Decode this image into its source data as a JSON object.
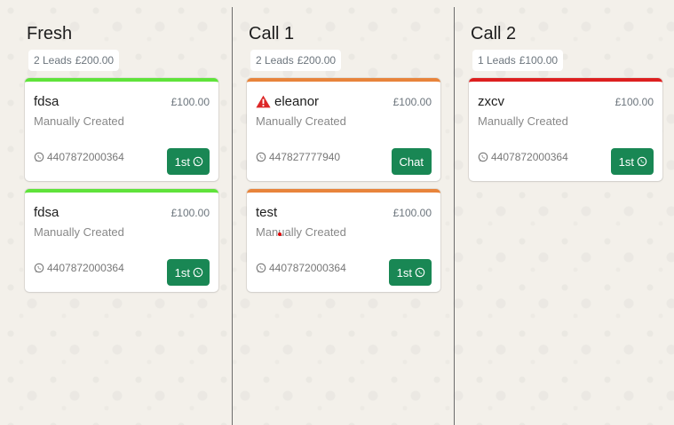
{
  "columns": [
    {
      "title": "Fresh",
      "lead_count": "2 Leads",
      "total": "£200.00",
      "cards": [
        {
          "name": "fdsa",
          "value": "£100.00",
          "source": "Manually Created",
          "phone": "4407872000364",
          "action": "1st",
          "stage_color": "#5fe33a",
          "warning": false
        },
        {
          "name": "fdsa",
          "value": "£100.00",
          "source": "Manually Created",
          "phone": "4407872000364",
          "action": "1st",
          "stage_color": "#5fe33a",
          "warning": false
        }
      ]
    },
    {
      "title": "Call 1",
      "lead_count": "2 Leads",
      "total": "£200.00",
      "cards": [
        {
          "name": "eleanor",
          "value": "£100.00",
          "source": "Manually Created",
          "phone": "447827777940",
          "action": "Chat",
          "stage_color": "#e8843b",
          "warning": true
        },
        {
          "name": "test",
          "value": "£100.00",
          "source": "Manually Created",
          "phone": "4407872000364",
          "action": "1st",
          "stage_color": "#e8843b",
          "warning": false
        }
      ]
    },
    {
      "title": "Call 2",
      "lead_count": "1 Leads",
      "total": "£100.00",
      "cards": [
        {
          "name": "zxcv",
          "value": "£100.00",
          "source": "Manually Created",
          "phone": "4407872000364",
          "action": "1st",
          "stage_color": "#dd1f1f",
          "warning": false
        }
      ]
    }
  ],
  "icons": {
    "phone": "whatsapp-icon",
    "action": "whatsapp-icon",
    "warning": "warning-triangle-icon"
  },
  "colors": {
    "action_button": "#198754",
    "warning": "#dc2626",
    "background": "#f3f0ea"
  }
}
